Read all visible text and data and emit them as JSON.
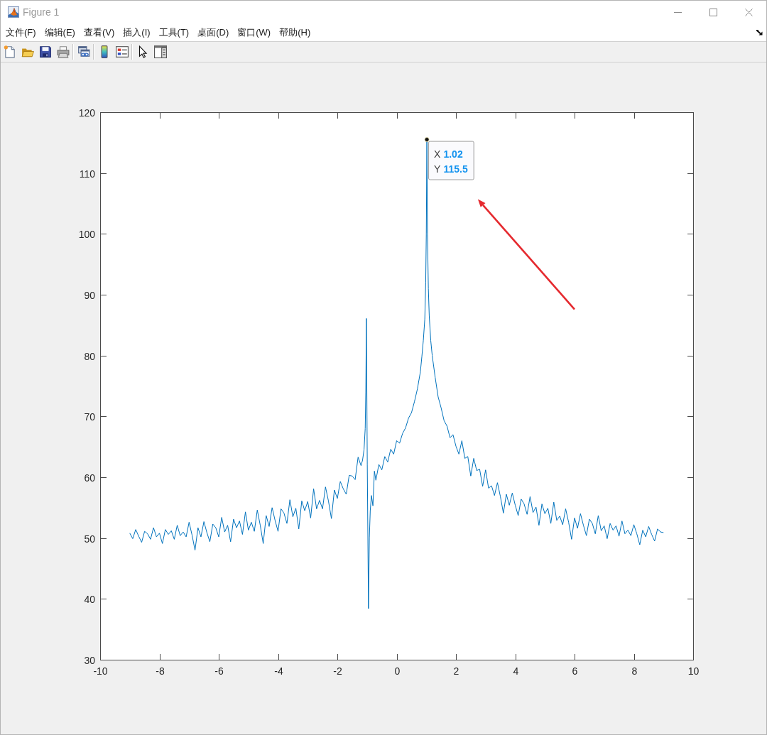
{
  "window": {
    "title": "Figure 1"
  },
  "menu": [
    "文件(F)",
    "编辑(E)",
    "查看(V)",
    "插入(I)",
    "工具(T)",
    "桌面(D)",
    "窗口(W)",
    "帮助(H)"
  ],
  "figure": {
    "chart_data": {
      "type": "line",
      "xlim": [
        -10,
        10
      ],
      "ylim": [
        30,
        120
      ],
      "xticks": [
        -10,
        -8,
        -6,
        -4,
        -2,
        0,
        2,
        4,
        6,
        8,
        10
      ],
      "yticks": [
        30,
        40,
        50,
        60,
        70,
        80,
        90,
        100,
        110,
        120
      ],
      "x": [
        -9,
        -8.9,
        -8.8,
        -8.7,
        -8.6,
        -8.5,
        -8.4,
        -8.3,
        -8.2,
        -8.1,
        -8,
        -7.9,
        -7.8,
        -7.7,
        -7.6,
        -7.5,
        -7.4,
        -7.3,
        -7.2,
        -7.1,
        -7,
        -6.9,
        -6.8,
        -6.7,
        -6.6,
        -6.5,
        -6.4,
        -6.3,
        -6.2,
        -6.1,
        -6,
        -5.9,
        -5.8,
        -5.7,
        -5.6,
        -5.5,
        -5.4,
        -5.3,
        -5.2,
        -5.1,
        -5,
        -4.9,
        -4.8,
        -4.7,
        -4.6,
        -4.5,
        -4.4,
        -4.3,
        -4.2,
        -4.1,
        -4,
        -3.9,
        -3.8,
        -3.7,
        -3.6,
        -3.5,
        -3.4,
        -3.3,
        -3.2,
        -3.1,
        -3,
        -2.9,
        -2.8,
        -2.7,
        -2.6,
        -2.5,
        -2.4,
        -2.3,
        -2.2,
        -2.1,
        -2,
        -1.9,
        -1.8,
        -1.7,
        -1.6,
        -1.5,
        -1.4,
        -1.3,
        -1.2,
        -1.15,
        -1.1,
        -1.06,
        -1.04,
        -1.02,
        -0.99,
        -0.95,
        -0.92,
        -0.89,
        -0.85,
        -0.8,
        -0.75,
        -0.7,
        -0.6,
        -0.5,
        -0.4,
        -0.3,
        -0.2,
        -0.1,
        0,
        0.1,
        0.2,
        0.3,
        0.4,
        0.5,
        0.6,
        0.7,
        0.8,
        0.85,
        0.9,
        0.95,
        0.98,
        1,
        1.02,
        1.04,
        1.07,
        1.1,
        1.15,
        1.2,
        1.3,
        1.4,
        1.5,
        1.6,
        1.7,
        1.8,
        1.9,
        2,
        2.1,
        2.2,
        2.3,
        2.4,
        2.5,
        2.6,
        2.7,
        2.8,
        2.9,
        3,
        3.1,
        3.2,
        3.3,
        3.4,
        3.5,
        3.6,
        3.7,
        3.8,
        3.9,
        4,
        4.1,
        4.2,
        4.3,
        4.4,
        4.5,
        4.6,
        4.7,
        4.8,
        4.9,
        5,
        5.1,
        5.2,
        5.3,
        5.4,
        5.5,
        5.6,
        5.7,
        5.8,
        5.9,
        6,
        6.1,
        6.2,
        6.3,
        6.4,
        6.5,
        6.6,
        6.7,
        6.8,
        6.9,
        7,
        7.1,
        7.2,
        7.3,
        7.4,
        7.5,
        7.6,
        7.7,
        7.8,
        7.9,
        8,
        8.1,
        8.2,
        8.3,
        8.4,
        8.5,
        8.6,
        8.7,
        8.8,
        8.9,
        9
      ],
      "series": [
        {
          "color": "#0072bd",
          "values": [
            50.8,
            49.9,
            51.4,
            50.3,
            49.3,
            51.1,
            50.7,
            49.8,
            51.7,
            50.2,
            50.8,
            49.1,
            51.4,
            50.6,
            51.2,
            49.8,
            52.1,
            50.4,
            51.0,
            50.2,
            52.6,
            50.5,
            48.0,
            51.7,
            50.2,
            52.7,
            50.9,
            49.4,
            52.3,
            51.7,
            50.2,
            53.4,
            51.0,
            52.1,
            49.4,
            53.1,
            51.7,
            52.8,
            50.6,
            54.3,
            51.3,
            52.6,
            51.1,
            54.6,
            52.1,
            49.1,
            53.7,
            51.9,
            55.0,
            52.9,
            51.1,
            54.8,
            54.1,
            52.4,
            56.3,
            53.5,
            54.9,
            51.5,
            56.1,
            54.5,
            56.0,
            53.3,
            58.1,
            54.8,
            56.2,
            54.8,
            58.4,
            56.1,
            53.2,
            57.9,
            56.5,
            59.3,
            58.1,
            57.2,
            60.3,
            60.2,
            59.6,
            63.3,
            61.9,
            62.8,
            64.5,
            68,
            74,
            86.1,
            62,
            38.4,
            50,
            54.5,
            57,
            55.3,
            61,
            59.5,
            62.1,
            61.2,
            63.4,
            62.5,
            64.6,
            63.8,
            66,
            65.6,
            67.2,
            68.1,
            69.7,
            70.6,
            72.4,
            74.5,
            77.3,
            79.8,
            82.5,
            86,
            92,
            100,
            115.5,
            100,
            91,
            86.5,
            82.5,
            80,
            76.4,
            73.2,
            71.4,
            69.3,
            68.4,
            66.5,
            67,
            65.1,
            63.8,
            66.0,
            63.1,
            63.4,
            60.2,
            63.1,
            61.1,
            61.3,
            58.5,
            61.2,
            58.2,
            58.6,
            57.0,
            59.1,
            56.8,
            54.1,
            57.2,
            55.4,
            57.4,
            55.4,
            53.7,
            56.4,
            55.6,
            53.9,
            56.8,
            54.2,
            55.1,
            52.1,
            55.6,
            54.0,
            54.9,
            52.4,
            55.9,
            52.9,
            53.6,
            52.2,
            54.8,
            52.6,
            49.8,
            53.3,
            51.6,
            54.0,
            52.1,
            50.4,
            53.1,
            52.4,
            50.7,
            53.7,
            51.2,
            52.0,
            49.9,
            52.4,
            51.3,
            52.0,
            50.3,
            52.8,
            50.7,
            51.3,
            50.4,
            52.2,
            50.7,
            48.9,
            51.3,
            50.2,
            51.9,
            50.6,
            49.5,
            51.5,
            51.0,
            50.9
          ]
        }
      ]
    },
    "datatip": {
      "rows": [
        {
          "label": "X",
          "value": "1.02"
        },
        {
          "label": "Y",
          "value": "115.5"
        }
      ]
    }
  }
}
